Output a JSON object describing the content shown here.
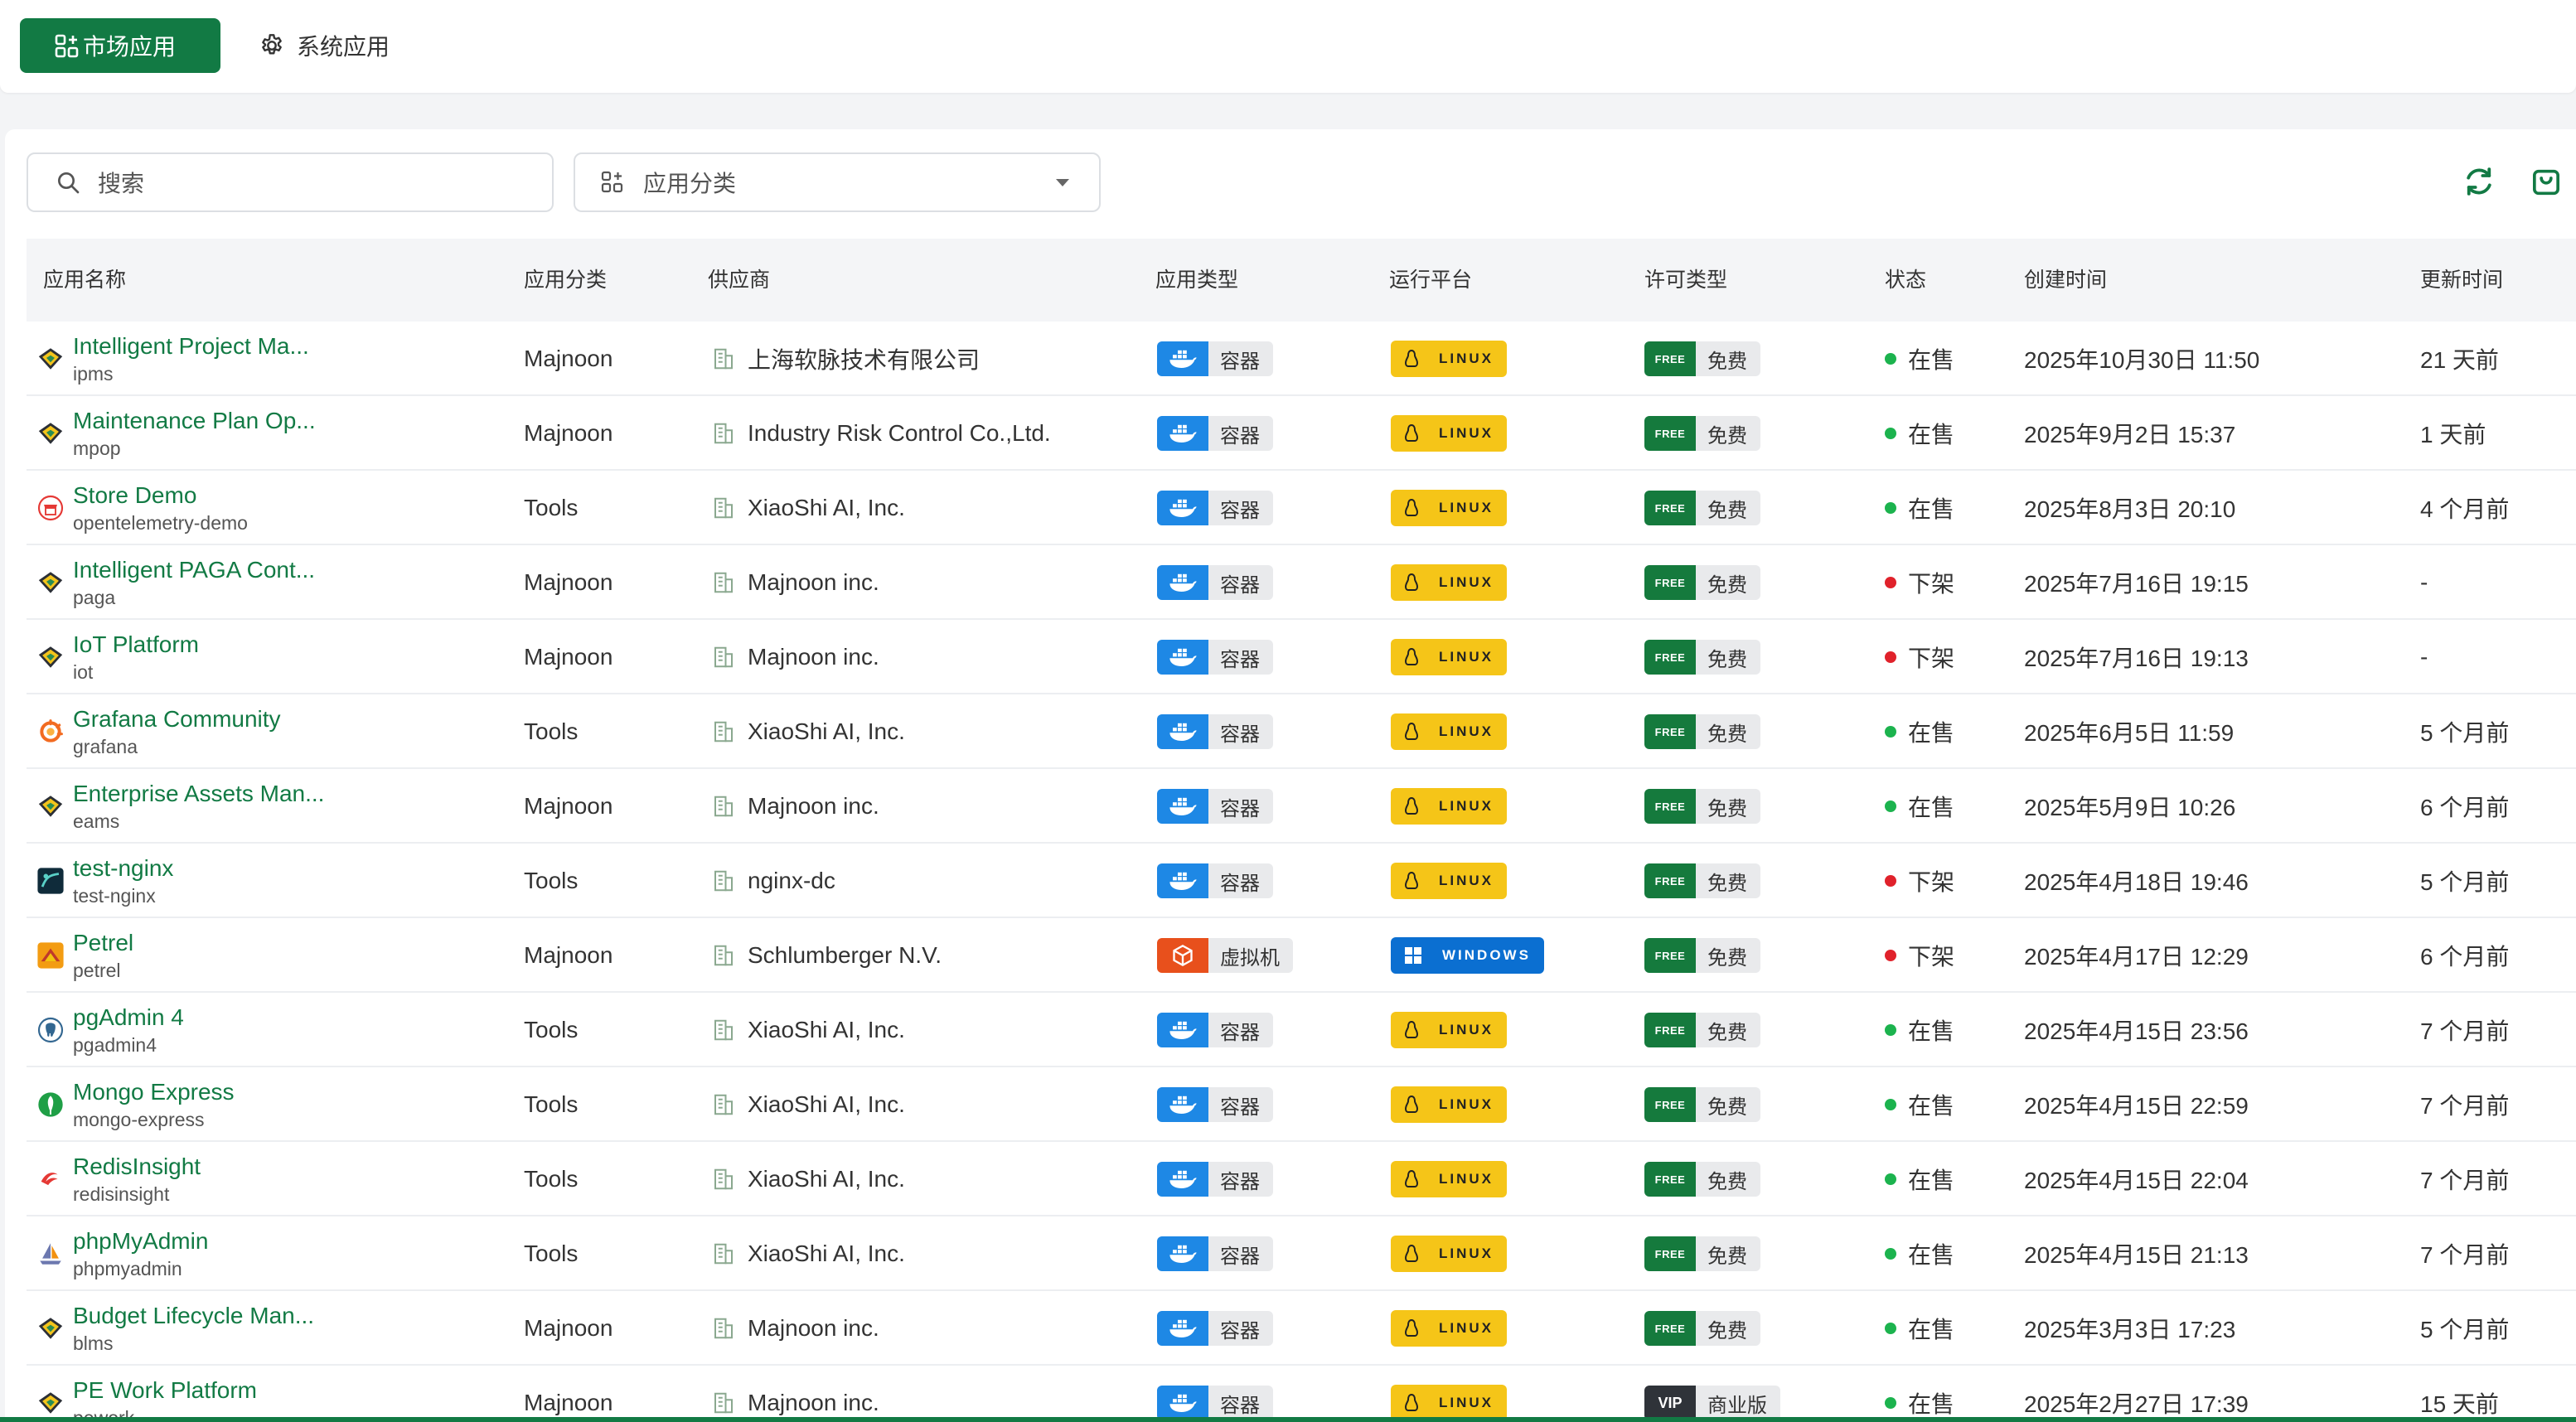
{
  "header": {
    "tabs": [
      {
        "label": "市场应用",
        "icon": "apps-grid-icon",
        "active": true
      },
      {
        "label": "系统应用",
        "icon": "gear-icon",
        "active": false
      }
    ]
  },
  "toolbar": {
    "search_placeholder": "搜索",
    "category_placeholder": "应用分类"
  },
  "colors": {
    "brand": "#127a44",
    "online": "#1cb34e",
    "offline": "#e0222b",
    "linux": "#f5c518",
    "windows": "#0b6fd1",
    "container": "#1e88e5",
    "vm": "#e8501c"
  },
  "table": {
    "columns": [
      "应用名称",
      "应用分类",
      "供应商",
      "应用类型",
      "运行平台",
      "许可类型",
      "状态",
      "创建时间",
      "更新时间"
    ],
    "rows": [
      {
        "name": "Intelligent Project Ma...",
        "id": "ipms",
        "icon": "majnoon-logo-icon",
        "category": "Majnoon",
        "vendor": "上海软脉技术有限公司",
        "type": "容器",
        "type_kind": "container",
        "platform": "LINUX",
        "license": "免费",
        "license_kind": "free",
        "status": "在售",
        "online": true,
        "created": "2025年10月30日 11:50",
        "updated": "21 天前"
      },
      {
        "name": "Maintenance Plan Op...",
        "id": "mpop",
        "icon": "majnoon-logo-icon",
        "category": "Majnoon",
        "vendor": "Industry Risk Control Co.,Ltd.",
        "type": "容器",
        "type_kind": "container",
        "platform": "LINUX",
        "license": "免费",
        "license_kind": "free",
        "status": "在售",
        "online": true,
        "created": "2025年9月2日 15:37",
        "updated": "1 天前"
      },
      {
        "name": "Store Demo",
        "id": "opentelemetry-demo",
        "icon": "store-icon",
        "category": "Tools",
        "vendor": "XiaoShi AI, Inc.",
        "type": "容器",
        "type_kind": "container",
        "platform": "LINUX",
        "license": "免费",
        "license_kind": "free",
        "status": "在售",
        "online": true,
        "created": "2025年8月3日 20:10",
        "updated": "4 个月前"
      },
      {
        "name": "Intelligent PAGA Cont...",
        "id": "paga",
        "icon": "majnoon-logo-icon",
        "category": "Majnoon",
        "vendor": "Majnoon inc.",
        "type": "容器",
        "type_kind": "container",
        "platform": "LINUX",
        "license": "免费",
        "license_kind": "free",
        "status": "下架",
        "online": false,
        "created": "2025年7月16日 19:15",
        "updated": "-"
      },
      {
        "name": "IoT Platform",
        "id": "iot",
        "icon": "majnoon-logo-icon",
        "category": "Majnoon",
        "vendor": "Majnoon inc.",
        "type": "容器",
        "type_kind": "container",
        "platform": "LINUX",
        "license": "免费",
        "license_kind": "free",
        "status": "下架",
        "online": false,
        "created": "2025年7月16日 19:13",
        "updated": "-"
      },
      {
        "name": "Grafana Community",
        "id": "grafana",
        "icon": "grafana-icon",
        "category": "Tools",
        "vendor": "XiaoShi AI, Inc.",
        "type": "容器",
        "type_kind": "container",
        "platform": "LINUX",
        "license": "免费",
        "license_kind": "free",
        "status": "在售",
        "online": true,
        "created": "2025年6月5日 11:59",
        "updated": "5 个月前"
      },
      {
        "name": "Enterprise Assets Man...",
        "id": "eams",
        "icon": "majnoon-logo-icon",
        "category": "Majnoon",
        "vendor": "Majnoon inc.",
        "type": "容器",
        "type_kind": "container",
        "platform": "LINUX",
        "license": "免费",
        "license_kind": "free",
        "status": "在售",
        "online": true,
        "created": "2025年5月9日 10:26",
        "updated": "6 个月前"
      },
      {
        "name": "test-nginx",
        "id": "test-nginx",
        "icon": "nginx-icon",
        "category": "Tools",
        "vendor": "nginx-dc",
        "type": "容器",
        "type_kind": "container",
        "platform": "LINUX",
        "license": "免费",
        "license_kind": "free",
        "status": "下架",
        "online": false,
        "created": "2025年4月18日 19:46",
        "updated": "5 个月前"
      },
      {
        "name": "Petrel",
        "id": "petrel",
        "icon": "petrel-icon",
        "category": "Majnoon",
        "vendor": "Schlumberger N.V.",
        "type": "虚拟机",
        "type_kind": "vm",
        "platform": "WINDOWS",
        "license": "免费",
        "license_kind": "free",
        "status": "下架",
        "online": false,
        "created": "2025年4月17日 12:29",
        "updated": "6 个月前"
      },
      {
        "name": "pgAdmin 4",
        "id": "pgadmin4",
        "icon": "postgres-elephant-icon",
        "category": "Tools",
        "vendor": "XiaoShi AI, Inc.",
        "type": "容器",
        "type_kind": "container",
        "platform": "LINUX",
        "license": "免费",
        "license_kind": "free",
        "status": "在售",
        "online": true,
        "created": "2025年4月15日 23:56",
        "updated": "7 个月前"
      },
      {
        "name": "Mongo Express",
        "id": "mongo-express",
        "icon": "mongo-leaf-icon",
        "category": "Tools",
        "vendor": "XiaoShi AI, Inc.",
        "type": "容器",
        "type_kind": "container",
        "platform": "LINUX",
        "license": "免费",
        "license_kind": "free",
        "status": "在售",
        "online": true,
        "created": "2025年4月15日 22:59",
        "updated": "7 个月前"
      },
      {
        "name": "RedisInsight",
        "id": "redisinsight",
        "icon": "redis-icon",
        "category": "Tools",
        "vendor": "XiaoShi AI, Inc.",
        "type": "容器",
        "type_kind": "container",
        "platform": "LINUX",
        "license": "免费",
        "license_kind": "free",
        "status": "在售",
        "online": true,
        "created": "2025年4月15日 22:04",
        "updated": "7 个月前"
      },
      {
        "name": "phpMyAdmin",
        "id": "phpmyadmin",
        "icon": "phpmyadmin-sail-icon",
        "category": "Tools",
        "vendor": "XiaoShi AI, Inc.",
        "type": "容器",
        "type_kind": "container",
        "platform": "LINUX",
        "license": "免费",
        "license_kind": "free",
        "status": "在售",
        "online": true,
        "created": "2025年4月15日 21:13",
        "updated": "7 个月前"
      },
      {
        "name": "Budget Lifecycle Man...",
        "id": "blms",
        "icon": "majnoon-logo-icon",
        "category": "Majnoon",
        "vendor": "Majnoon inc.",
        "type": "容器",
        "type_kind": "container",
        "platform": "LINUX",
        "license": "免费",
        "license_kind": "free",
        "status": "在售",
        "online": true,
        "created": "2025年3月3日 17:23",
        "updated": "5 个月前"
      },
      {
        "name": "PE Work Platform",
        "id": "pework",
        "icon": "majnoon-logo-icon",
        "category": "Majnoon",
        "vendor": "Majnoon inc.",
        "type": "容器",
        "type_kind": "container",
        "platform": "LINUX",
        "license": "商业版",
        "license_kind": "vip",
        "status": "在售",
        "online": true,
        "created": "2025年2月27日 17:39",
        "updated": "15 天前"
      }
    ]
  }
}
